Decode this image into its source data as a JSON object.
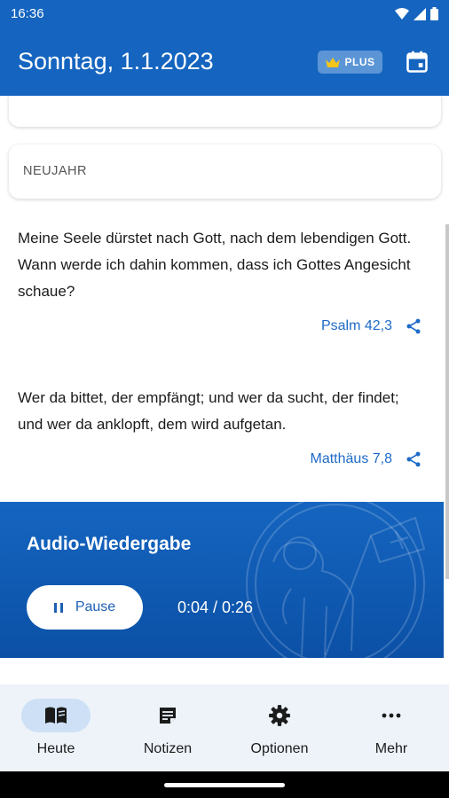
{
  "status_bar": {
    "time": "16:36"
  },
  "app_bar": {
    "title": "Sonntag, 1.1.2023",
    "plus_badge": "PLUS"
  },
  "feast": {
    "label": "NEUJAHR"
  },
  "verses": [
    {
      "text": "Meine Seele dürstet nach Gott, nach dem lebendigen Gott. Wann werde ich dahin kommen, dass ich Gottes Angesicht schaue?",
      "reference": "Psalm 42,3"
    },
    {
      "text": "Wer da bittet, der empfängt; und wer da sucht, der findet; und wer da anklopft, dem wird aufgetan.",
      "reference": "Matthäus 7,8"
    }
  ],
  "audio": {
    "title": "Audio-Wiedergabe",
    "button_label": "Pause",
    "time": "0:04 / 0:26"
  },
  "nav": {
    "items": [
      {
        "label": "Heute",
        "icon": "book-open-icon",
        "active": true
      },
      {
        "label": "Notizen",
        "icon": "note-icon",
        "active": false
      },
      {
        "label": "Optionen",
        "icon": "gear-icon",
        "active": false
      },
      {
        "label": "Mehr",
        "icon": "more-horizontal-icon",
        "active": false
      }
    ]
  },
  "colors": {
    "primary": "#1565c0",
    "accent_text": "#1e6bc7",
    "nav_bg": "#eef3fa",
    "nav_active": "#cde0f5",
    "crown": "#f5c518"
  }
}
